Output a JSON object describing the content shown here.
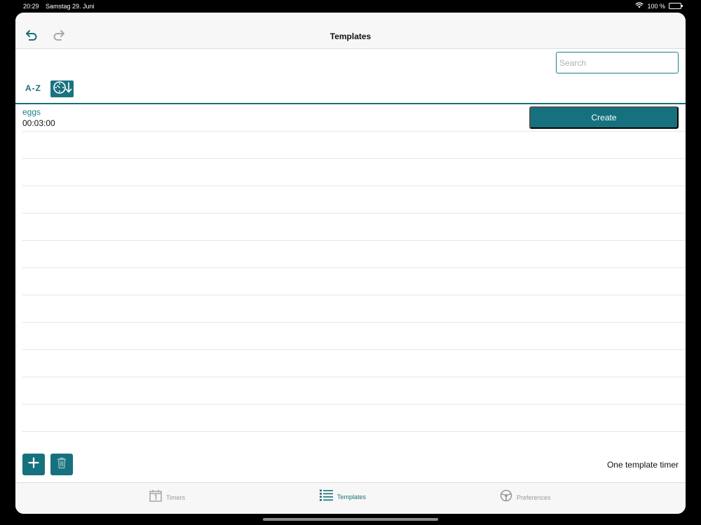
{
  "status_bar": {
    "time": "20:29",
    "date": "Samstag 29. Juni",
    "battery": "100 %"
  },
  "nav": {
    "title": "Templates"
  },
  "search": {
    "placeholder": "Search",
    "value": ""
  },
  "sort": {
    "az_label": "A-Z"
  },
  "templates": [
    {
      "name": "eggs",
      "duration": "00:03:00",
      "action_label": "Create"
    }
  ],
  "footer": {
    "status": "One template timer"
  },
  "tabbar": {
    "tabs": [
      {
        "label": "Timers",
        "icon": "calendar-icon"
      },
      {
        "label": "Templates",
        "icon": "list-icon"
      },
      {
        "label": "Preferences",
        "icon": "steering-wheel-icon"
      }
    ]
  },
  "colors": {
    "accent": "#16717e",
    "link": "#1f7e89"
  }
}
